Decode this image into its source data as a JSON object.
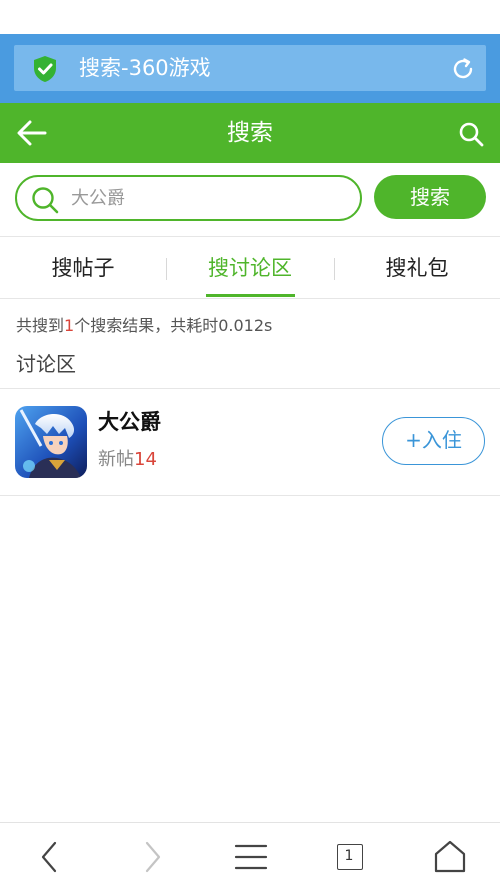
{
  "browser": {
    "address_title": "搜索-360游戏",
    "tab_count": "1"
  },
  "header": {
    "title": "搜索"
  },
  "search": {
    "query": "大公爵",
    "button_label": "搜索"
  },
  "tabs": [
    {
      "label": "搜帖子",
      "active": false
    },
    {
      "label": "搜讨论区",
      "active": true
    },
    {
      "label": "搜礼包",
      "active": false
    }
  ],
  "results": {
    "summary_prefix": "共搜到",
    "count": "1",
    "summary_suffix": "个搜索结果，共耗时0.012s",
    "section_label": "讨论区",
    "items": [
      {
        "name": "大公爵",
        "posts_label": "新帖",
        "posts_count": "14",
        "join_label": "+入住"
      }
    ]
  },
  "colors": {
    "brand_green": "#4fb52b",
    "browser_blue": "#4a9be0",
    "link_blue": "#3a95d8",
    "highlight_red": "#d9453a"
  },
  "icons": [
    "shield-check-icon",
    "reload-icon",
    "back-arrow-icon",
    "search-icon",
    "chevron-left-icon",
    "chevron-right-icon",
    "menu-icon",
    "tabs-icon",
    "home-icon"
  ]
}
